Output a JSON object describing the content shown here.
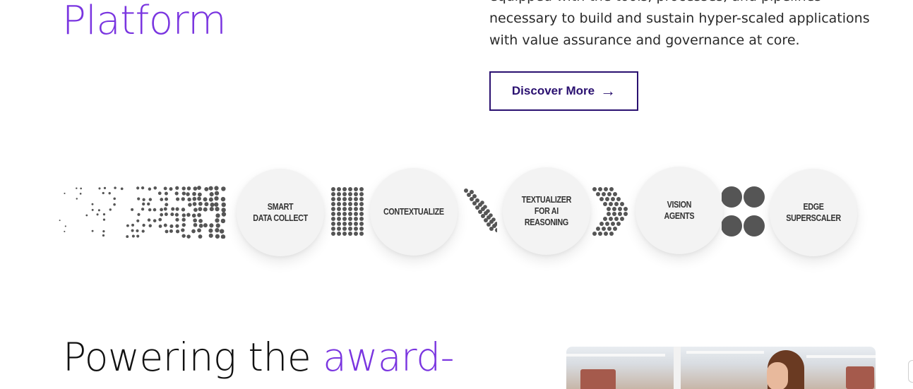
{
  "hero": {
    "title": "Platform",
    "description": "equipped with the tools, processes, and pipelines necessary to build and sustain hyper-scaled applications with value assurance and governance at core.",
    "cta_label": "Discover More",
    "cta_arrow": "→"
  },
  "pipeline": {
    "stages": [
      {
        "label": "SMART\nDATA COLLECT"
      },
      {
        "label": "CONTEXTUALIZE"
      },
      {
        "label": "TEXTUALIZER\nFOR AI\nREASONING"
      },
      {
        "label": "VISION\nAGENTS"
      },
      {
        "label": "EDGE\nSUPERSCALER"
      }
    ]
  },
  "section": {
    "title_main": "Powering the ",
    "title_accent": "award-"
  },
  "colors": {
    "accent": "#7a35e0",
    "button_border": "#2a1070",
    "dots": "#555555"
  },
  "icons": [
    "arrow-right-icon"
  ]
}
